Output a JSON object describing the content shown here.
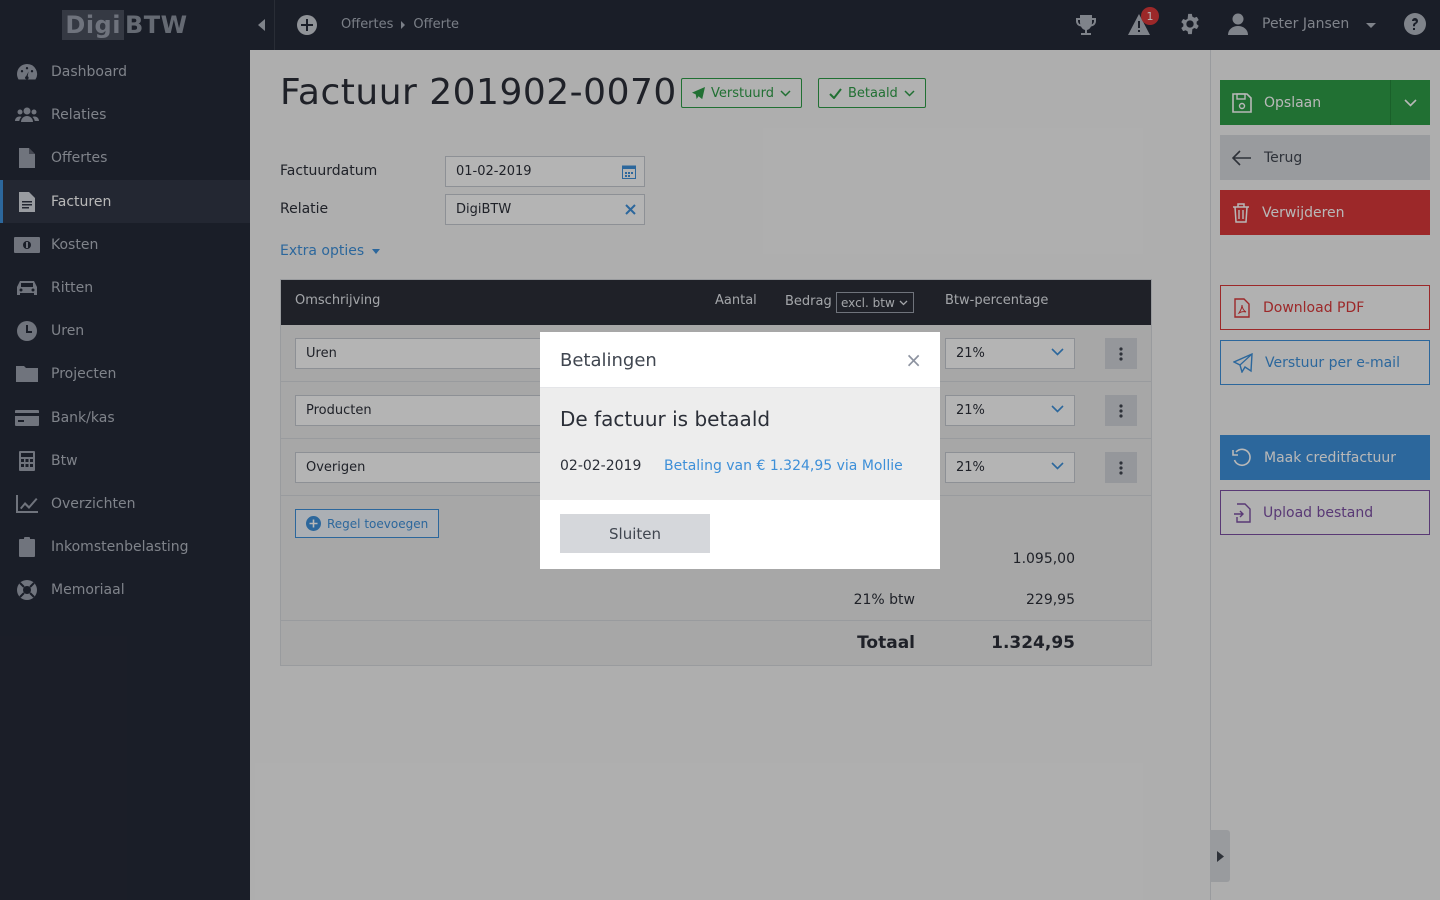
{
  "app": {
    "logo_part1": "Digi",
    "logo_part2": "BTW"
  },
  "sidebar": {
    "items": [
      {
        "label": "Dashboard"
      },
      {
        "label": "Relaties"
      },
      {
        "label": "Offertes"
      },
      {
        "label": "Facturen"
      },
      {
        "label": "Kosten"
      },
      {
        "label": "Ritten"
      },
      {
        "label": "Uren"
      },
      {
        "label": "Projecten"
      },
      {
        "label": "Bank/kas"
      },
      {
        "label": "Btw"
      },
      {
        "label": "Overzichten"
      },
      {
        "label": "Inkomstenbelasting"
      },
      {
        "label": "Memoriaal"
      }
    ]
  },
  "topbar": {
    "breadcrumbs": [
      "Offertes",
      "Offerte"
    ],
    "notification_count": "1",
    "user_name": "Peter Jansen"
  },
  "invoice": {
    "title": "Factuur 201902-0070",
    "status_sent": "Verstuurd",
    "status_paid": "Betaald",
    "date_label": "Factuurdatum",
    "date_value": "01-02-2019",
    "relation_label": "Relatie",
    "relation_value": "DigiBTW",
    "extra_options": "Extra opties"
  },
  "table": {
    "headers": {
      "description": "Omschrijving",
      "quantity": "Aantal",
      "amount": "Bedrag",
      "amount_mode": "excl. btw",
      "vat": "Btw-percentage"
    },
    "rows": [
      {
        "description": "Uren",
        "vat": "21%"
      },
      {
        "description": "Producten",
        "vat": "21%"
      },
      {
        "description": "Overigen",
        "vat": "21%"
      }
    ],
    "add_row_label": "Regel toevoegen",
    "subtotal": "1.095,00",
    "vat_label": "21% btw",
    "vat_amount": "229,95",
    "total_label": "Totaal",
    "total_amount": "1.324,95"
  },
  "actions": {
    "save": "Opslaan",
    "back": "Terug",
    "delete": "Verwijderen",
    "download_pdf": "Download PDF",
    "send_email": "Verstuur per e-mail",
    "credit_invoice": "Maak creditfactuur",
    "upload_file": "Upload bestand"
  },
  "modal": {
    "title": "Betalingen",
    "message": "De factuur is betaald",
    "payment_date": "02-02-2019",
    "payment_text": "Betaling van € 1.324,95 via Mollie",
    "close_button": "Sluiten"
  },
  "colors": {
    "sidebar_bg": "#252a38",
    "accent_blue": "#3d8fd8",
    "success_green": "#2e9c47",
    "danger_red": "#d9383a",
    "purple": "#7c4fa3"
  }
}
